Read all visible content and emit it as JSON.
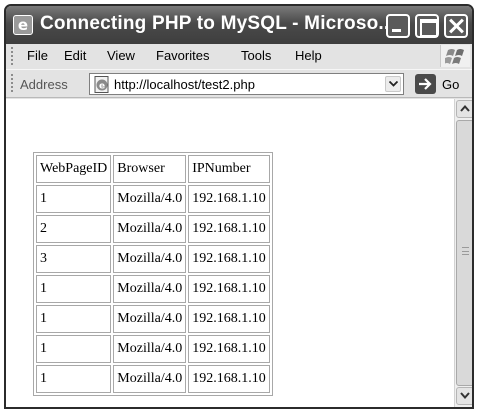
{
  "window": {
    "title": "Connecting PHP to MySQL - Microso...",
    "app_icon": "ie-page-icon",
    "controls": [
      "minimize-icon",
      "maximize-icon",
      "close-icon"
    ]
  },
  "menu": {
    "items": [
      {
        "label": "File"
      },
      {
        "label": "Edit"
      },
      {
        "label": "View"
      },
      {
        "label": "Favorites"
      },
      {
        "label": "Tools"
      },
      {
        "label": "Help"
      }
    ],
    "logo_icon": "windows-flag-icon"
  },
  "address": {
    "label": "Address",
    "url": "http://localhost/test2.php",
    "go_label": "Go"
  },
  "table": {
    "headers": [
      "WebPageID",
      "Browser",
      "IPNumber"
    ],
    "rows": [
      [
        "1",
        "Mozilla/4.0",
        "192.168.1.10"
      ],
      [
        "2",
        "Mozilla/4.0",
        "192.168.1.10"
      ],
      [
        "3",
        "Mozilla/4.0",
        "192.168.1.10"
      ],
      [
        "1",
        "Mozilla/4.0",
        "192.168.1.10"
      ],
      [
        "1",
        "Mozilla/4.0",
        "192.168.1.10"
      ],
      [
        "1",
        "Mozilla/4.0",
        "192.168.1.10"
      ],
      [
        "1",
        "Mozilla/4.0",
        "192.168.1.10"
      ]
    ]
  },
  "colors": {
    "titlebar": "#4a4a4a",
    "chrome": "#e3e3e3",
    "table_border": "#a8a8a8"
  }
}
